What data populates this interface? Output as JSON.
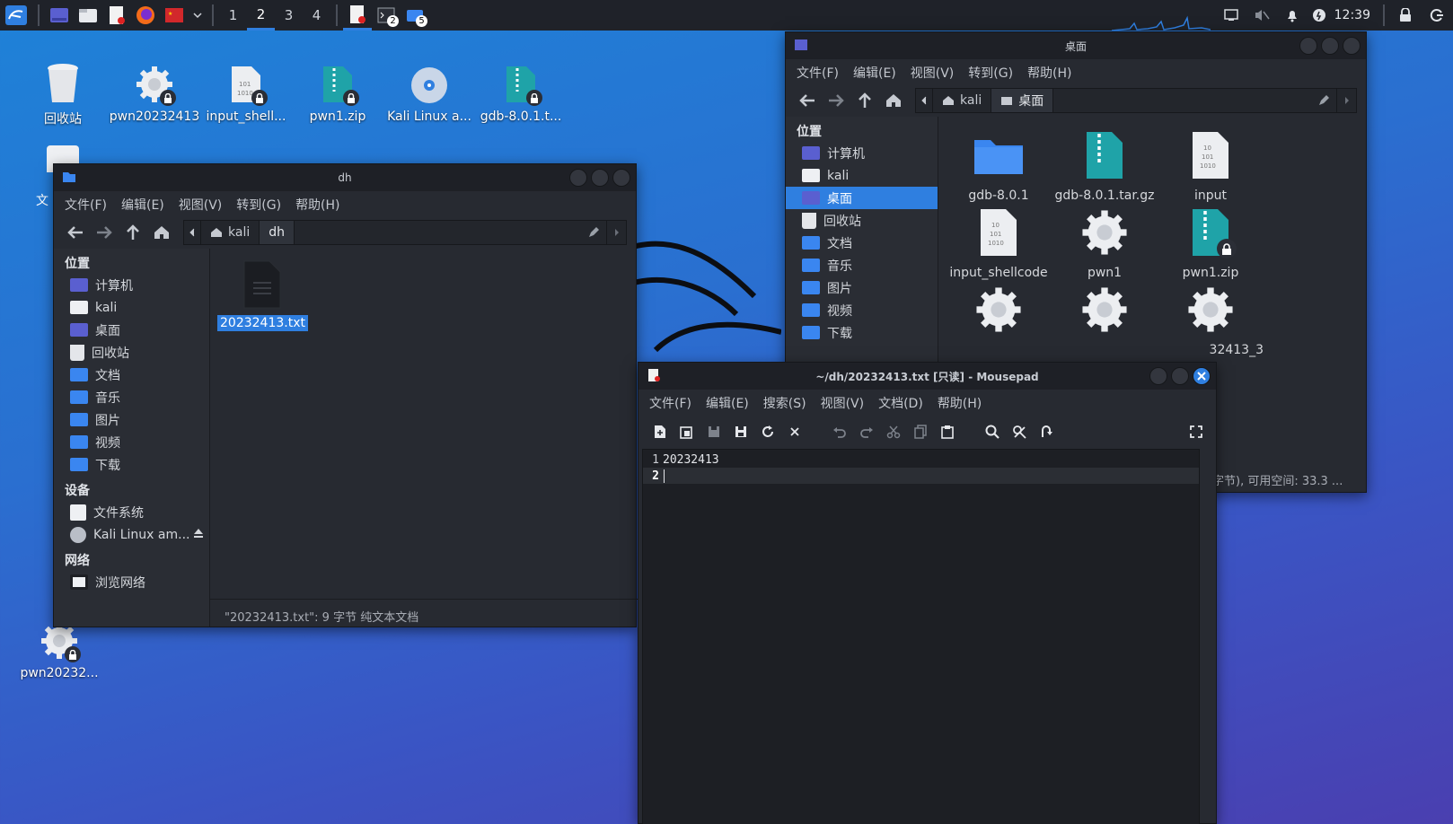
{
  "panel": {
    "workspaces": [
      "1",
      "2",
      "3",
      "4"
    ],
    "active_workspace": "2",
    "task_badges": [
      "2",
      "5"
    ],
    "clock": "12:39"
  },
  "desktop": {
    "icons": [
      {
        "label": "回收站",
        "icon": "trash-icon"
      },
      {
        "label": "pwn20232413",
        "icon": "gear-icon"
      },
      {
        "label": "input_shell...",
        "icon": "binary-file-icon"
      },
      {
        "label": "pwn1.zip",
        "icon": "zip-icon"
      },
      {
        "label": "Kali Linux a...",
        "icon": "disc-icon"
      },
      {
        "label": "gdb-8.0.1.t...",
        "icon": "zip-icon"
      }
    ],
    "partial_label": "文",
    "bottom_icon_label": "pwn20232..."
  },
  "fm_dh": {
    "title": "dh",
    "menu": [
      "文件(F)",
      "编辑(E)",
      "视图(V)",
      "转到(G)",
      "帮助(H)"
    ],
    "path": [
      "kali",
      "dh"
    ],
    "sidebar": {
      "places_header": "位置",
      "places": [
        "计算机",
        "kali",
        "桌面",
        "回收站",
        "文档",
        "音乐",
        "图片",
        "视频",
        "下载"
      ],
      "devices_header": "设备",
      "devices": [
        "文件系统",
        "Kali Linux am..."
      ],
      "network_header": "网络",
      "network": [
        "浏览网络"
      ]
    },
    "files": [
      {
        "name": "20232413.txt",
        "selected": true
      }
    ],
    "status": "\"20232413.txt\": 9 字节 纯文本文档"
  },
  "fm_desktop": {
    "title": "桌面",
    "menu": [
      "文件(F)",
      "编辑(E)",
      "视图(V)",
      "转到(G)",
      "帮助(H)"
    ],
    "path": [
      "kali",
      "桌面"
    ],
    "sidebar": {
      "places_header": "位置",
      "places": [
        "计算机",
        "kali",
        "桌面",
        "回收站",
        "文档",
        "音乐",
        "图片",
        "视频",
        "下载"
      ],
      "selected": "桌面"
    },
    "files": [
      {
        "name": "gdb-8.0.1",
        "icon": "folder-icon"
      },
      {
        "name": "gdb-8.0.1.tar.gz",
        "icon": "zip-icon"
      },
      {
        "name": "input",
        "icon": "binary-file-icon"
      },
      {
        "name": "input_shellcode",
        "icon": "binary-file-icon"
      },
      {
        "name": "pwn1",
        "icon": "gear-icon"
      },
      {
        "name": "pwn1.zip",
        "icon": "zip-icon"
      },
      {
        "name": "",
        "icon": "gear-icon"
      },
      {
        "name": "",
        "icon": "gear-icon"
      },
      {
        "name": "32413_3",
        "icon": "gear-icon"
      }
    ],
    "status": "字节), 可用空间: 33.3 ..."
  },
  "mousepad": {
    "title": "~/dh/20232413.txt [只读] - Mousepad",
    "menu": [
      "文件(F)",
      "编辑(E)",
      "搜索(S)",
      "视图(V)",
      "文档(D)",
      "帮助(H)"
    ],
    "lines": [
      {
        "num": "1",
        "text": "20232413"
      },
      {
        "num": "2",
        "text": ""
      }
    ]
  },
  "colors": {
    "accent": "#2f7fe0",
    "window_bg": "#272a31",
    "panel_bg": "#1f2229",
    "folder": "#3a86f0",
    "zip": "#1fa3a8"
  }
}
